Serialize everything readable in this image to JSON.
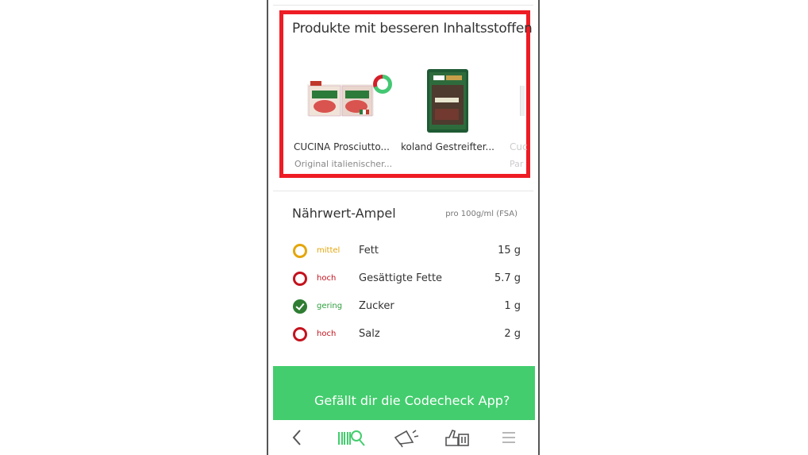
{
  "better_products": {
    "title": "Produkte mit besseren Inhaltsstoffen",
    "items": [
      {
        "name": "CUCINA Prosciutto...",
        "description": "Original italienischer..."
      },
      {
        "name": "koland Gestreifter...",
        "description": ""
      },
      {
        "name": "Cuc",
        "description": "Par"
      }
    ]
  },
  "nutrition": {
    "title": "Nährwert-Ampel",
    "unit": "pro 100g/ml (FSA)",
    "rows": [
      {
        "level": "mittel",
        "nutrient": "Fett",
        "value": "15 g",
        "status_color": "#e4a60b"
      },
      {
        "level": "hoch",
        "nutrient": "Gesättigte Fette",
        "value": "5.7 g",
        "status_color": "#c4121d"
      },
      {
        "level": "gering",
        "nutrient": "Zucker",
        "value": "1 g",
        "status_color": "#2e7d32"
      },
      {
        "level": "hoch",
        "nutrient": "Salz",
        "value": "2 g",
        "status_color": "#c4121d"
      }
    ]
  },
  "cta": {
    "label": "Gefällt dir die Codecheck App?"
  },
  "nav": {
    "icons": [
      "back-icon",
      "barcode-scan-icon",
      "megaphone-icon",
      "rating-icon",
      "menu-icon"
    ]
  },
  "colors": {
    "highlight": "#ee1c24",
    "cta": "#43cd6e",
    "accent": "#43cd6e"
  }
}
